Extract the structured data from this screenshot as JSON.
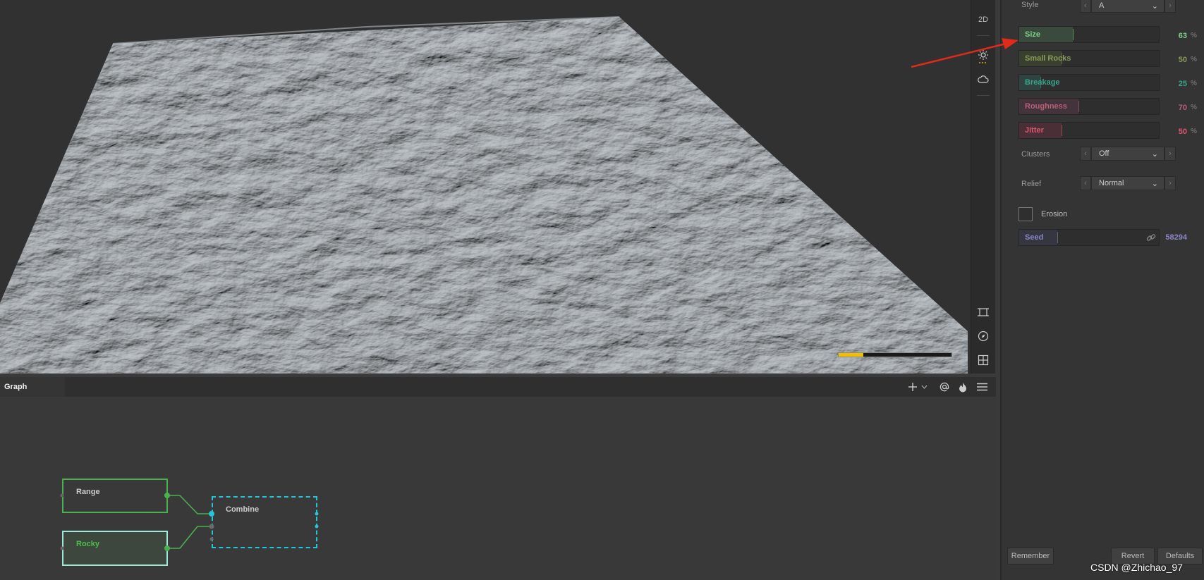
{
  "viewport": {
    "mode_button": "2D",
    "scale_fraction": 0.22
  },
  "properties": {
    "style": {
      "label": "Style",
      "value": "A"
    },
    "sliders": [
      {
        "label": "Size",
        "value": "63",
        "unit": "%",
        "fraction": 0.63,
        "color": "#7fd08a",
        "fill": "#3a4a3c"
      },
      {
        "label": "Small Rocks",
        "value": "50",
        "unit": "%",
        "fraction": 0.5,
        "color": "#8a9a5a",
        "fill": "#39402f"
      },
      {
        "label": "Breakage",
        "value": "25",
        "unit": "%",
        "fraction": 0.25,
        "color": "#3aa58c",
        "fill": "#2f4440"
      },
      {
        "label": "Roughness",
        "value": "70",
        "unit": "%",
        "fraction": 0.7,
        "color": "#b8607a",
        "fill": "#43333a"
      },
      {
        "label": "Jitter",
        "value": "50",
        "unit": "%",
        "fraction": 0.5,
        "color": "#d85a70",
        "fill": "#4a3036"
      }
    ],
    "clusters": {
      "label": "Clusters",
      "value": "Off"
    },
    "relief": {
      "label": "Relief",
      "value": "Normal"
    },
    "erosion": {
      "label": "Erosion",
      "checked": false
    },
    "seed": {
      "label": "Seed",
      "value": "58294",
      "fraction": 0.45,
      "color": "#8a86c8"
    },
    "buttons": {
      "remember": "Remember",
      "revert": "Revert",
      "defaults": "Defaults"
    }
  },
  "graph": {
    "tab_label": "Graph",
    "nodes": [
      {
        "title": "Range",
        "color": "#ffffff",
        "border": "#4caf50"
      },
      {
        "title": "Rocky",
        "color": "#4cc04c",
        "border": "#9ee8d8"
      },
      {
        "title": "Combine",
        "color": "#ffffff",
        "border": "#26c6da"
      }
    ]
  },
  "icons": {
    "toolbar": [
      "sun-icon",
      "cloud-icon",
      "frame-icon",
      "compass-icon",
      "grid-icon"
    ],
    "graph_header": [
      "plus-icon",
      "chevron-down-icon",
      "at-icon",
      "flame-icon",
      "menu-icon"
    ]
  },
  "watermark": "CSDN @Zhichao_97"
}
